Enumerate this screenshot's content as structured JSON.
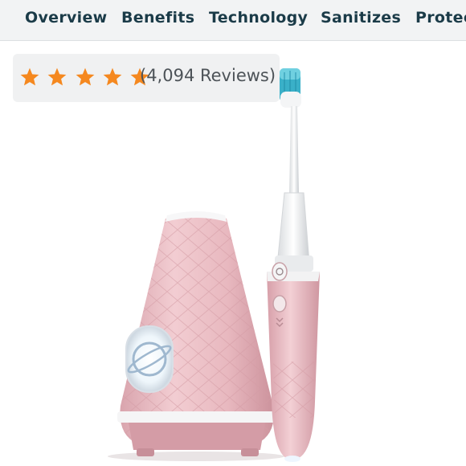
{
  "nav": {
    "tabs": [
      {
        "label": "Overview"
      },
      {
        "label": "Benefits"
      },
      {
        "label": "Technology"
      },
      {
        "label": "Sanitizes"
      },
      {
        "label": "Protec"
      }
    ]
  },
  "rating": {
    "stars": 5,
    "star_color": "#f5881f",
    "reviews_label": "(4,094 Reviews)"
  },
  "product": {
    "name": "pink sonic toothbrush with sanitizing base",
    "body_color": "#e9bcc2",
    "bristle_color": "#3ab0c8"
  }
}
